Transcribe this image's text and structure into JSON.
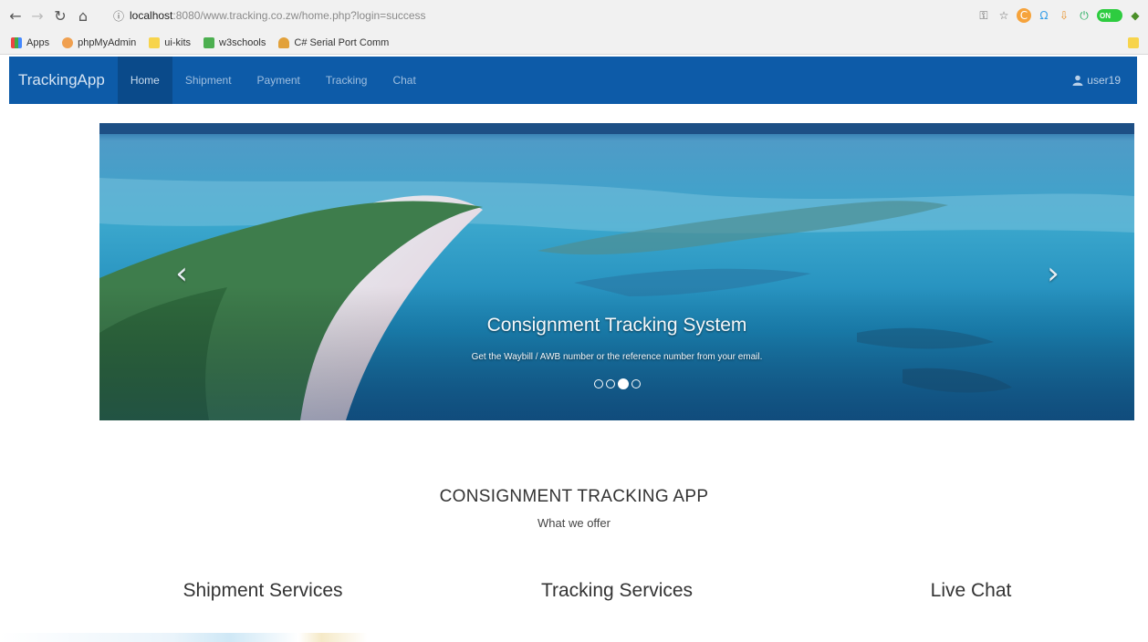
{
  "browser": {
    "url_host": "localhost",
    "url_path": ":8080/www.tracking.co.zw/home.php?login=success",
    "bookmarks": [
      "Apps",
      "phpMyAdmin",
      "ui-kits",
      "w3schools",
      "C# Serial Port Comm"
    ],
    "toggle_label": "ON"
  },
  "navbar": {
    "brand": "TrackingApp",
    "items": [
      {
        "label": "Home"
      },
      {
        "label": "Shipment"
      },
      {
        "label": "Payment"
      },
      {
        "label": "Tracking"
      },
      {
        "label": "Chat"
      }
    ],
    "user": "user19"
  },
  "carousel": {
    "title": "Consignment Tracking System",
    "text": "Get the Waybill / AWB number or the reference number from your email.",
    "slide_count": 4,
    "active_slide": 3
  },
  "section": {
    "title": "CONSIGNMENT TRACKING APP",
    "subtitle": "What we offer",
    "services": [
      "Shipment Services",
      "Tracking Services",
      "Live Chat"
    ]
  },
  "colors": {
    "navbar": "#0d5ba8",
    "navbar_active": "#0a4a8a"
  }
}
